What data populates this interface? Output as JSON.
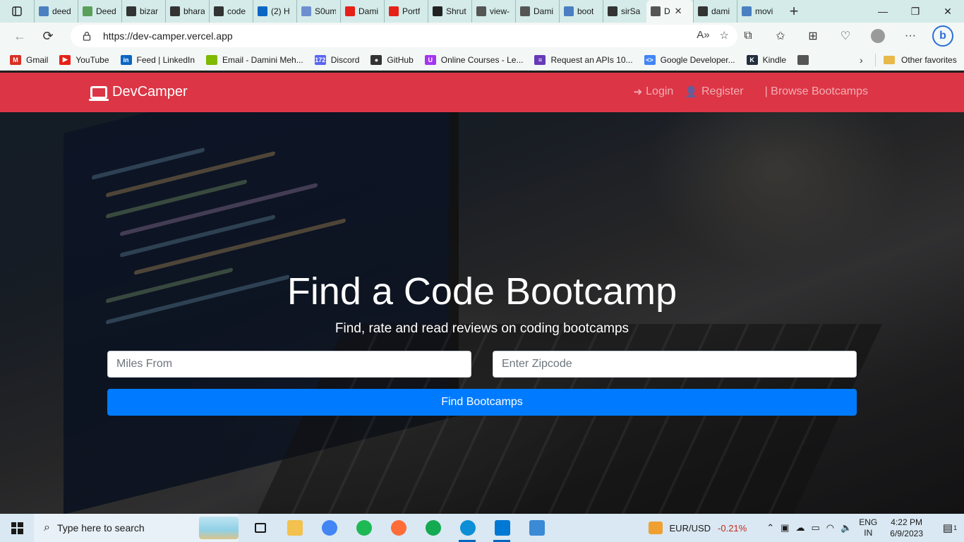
{
  "browser": {
    "tabs": [
      {
        "label": "deed",
        "icon": "search-icon",
        "color": "#4a7fc1"
      },
      {
        "label": "Deed",
        "icon": "leaf-icon",
        "color": "#5aa05a"
      },
      {
        "label": "bizar",
        "icon": "github-icon",
        "color": "#333333"
      },
      {
        "label": "bhara",
        "icon": "github-icon",
        "color": "#333333"
      },
      {
        "label": "code",
        "icon": "github-icon",
        "color": "#333333"
      },
      {
        "label": "(2) H",
        "icon": "linkedin-icon",
        "color": "#0a66c2"
      },
      {
        "label": "S0um",
        "icon": "globe-icon",
        "color": "#6d8fd0"
      },
      {
        "label": "Dami",
        "icon": "youtube-icon",
        "color": "#e62117"
      },
      {
        "label": "Portf",
        "icon": "youtube-icon",
        "color": "#e62117"
      },
      {
        "label": "Shrut",
        "icon": "dollar-icon",
        "color": "#222222"
      },
      {
        "label": "view-",
        "icon": "page-icon",
        "color": "#555555"
      },
      {
        "label": "Dami",
        "icon": "page-icon",
        "color": "#555555"
      },
      {
        "label": "boot",
        "icon": "search-icon",
        "color": "#4a7fc1"
      },
      {
        "label": "sirSa",
        "icon": "github-icon",
        "color": "#333333"
      },
      {
        "label": "D",
        "icon": "page-icon",
        "color": "#555555",
        "active": true
      },
      {
        "label": "dami",
        "icon": "github-icon",
        "color": "#333333"
      },
      {
        "label": "movi",
        "icon": "search-icon",
        "color": "#4a7fc1"
      }
    ],
    "url": "https://dev-camper.vercel.app",
    "favorites": [
      {
        "label": "Gmail",
        "icon": "gmail-icon",
        "color": "#d93025",
        "glyph": "M"
      },
      {
        "label": "YouTube",
        "icon": "youtube-icon",
        "color": "#e62117",
        "glyph": "▶"
      },
      {
        "label": "Feed | LinkedIn",
        "icon": "linkedin-icon",
        "color": "#0a66c2",
        "glyph": "in"
      },
      {
        "label": "Email - Damini Meh...",
        "icon": "microsoft-icon",
        "color": "#7fba00",
        "glyph": ""
      },
      {
        "label": "Discord",
        "icon": "discord-icon",
        "color": "#5865f2",
        "glyph": "172"
      },
      {
        "label": "GitHub",
        "icon": "github-icon",
        "color": "#333333",
        "glyph": "●"
      },
      {
        "label": "Online Courses - Le...",
        "icon": "udemy-icon",
        "color": "#a435f0",
        "glyph": "U"
      },
      {
        "label": "Request an APIs 10...",
        "icon": "form-icon",
        "color": "#673ab7",
        "glyph": "≡"
      },
      {
        "label": "Google Developer...",
        "icon": "code-icon",
        "color": "#4285f4",
        "glyph": "<>"
      },
      {
        "label": "Kindle",
        "icon": "kindle-icon",
        "color": "#232f3e",
        "glyph": "K"
      },
      {
        "label": "",
        "icon": "page-icon",
        "color": "#555555",
        "glyph": ""
      }
    ],
    "other_favorites": "Other favorites"
  },
  "site": {
    "brand": "DevCamper",
    "nav": {
      "login": "Login",
      "register": "Register",
      "browse": "| Browse Bootcamps"
    },
    "hero": {
      "title": "Find a Code Bootcamp",
      "subtitle": "Find, rate and read reviews on coding bootcamps",
      "miles_placeholder": "Miles From",
      "zip_placeholder": "Enter Zipcode",
      "button": "Find Bootcamps"
    },
    "colors": {
      "navbar": "#dc3545",
      "button": "#007bff"
    }
  },
  "taskbar": {
    "search_placeholder": "Type here to search",
    "apps": [
      {
        "name": "task-view",
        "color": "#1a1a1a"
      },
      {
        "name": "file-explorer",
        "color": "#f2c14e"
      },
      {
        "name": "chrome",
        "color": "#4285f4"
      },
      {
        "name": "spotify",
        "color": "#1db954"
      },
      {
        "name": "postman",
        "color": "#ff6c37"
      },
      {
        "name": "mongodb-compass",
        "color": "#13aa52"
      },
      {
        "name": "edge",
        "color": "#0c8fd6",
        "running": true
      },
      {
        "name": "vscode",
        "color": "#0078d4",
        "running": true
      },
      {
        "name": "photos",
        "color": "#3a8ad6"
      }
    ],
    "ticker": {
      "symbol": "EUR/USD",
      "change": "-0.21%"
    },
    "lang": {
      "line1": "ENG",
      "line2": "IN"
    },
    "clock": {
      "time": "4:22 PM",
      "date": "6/9/2023"
    },
    "notifications": "1"
  }
}
